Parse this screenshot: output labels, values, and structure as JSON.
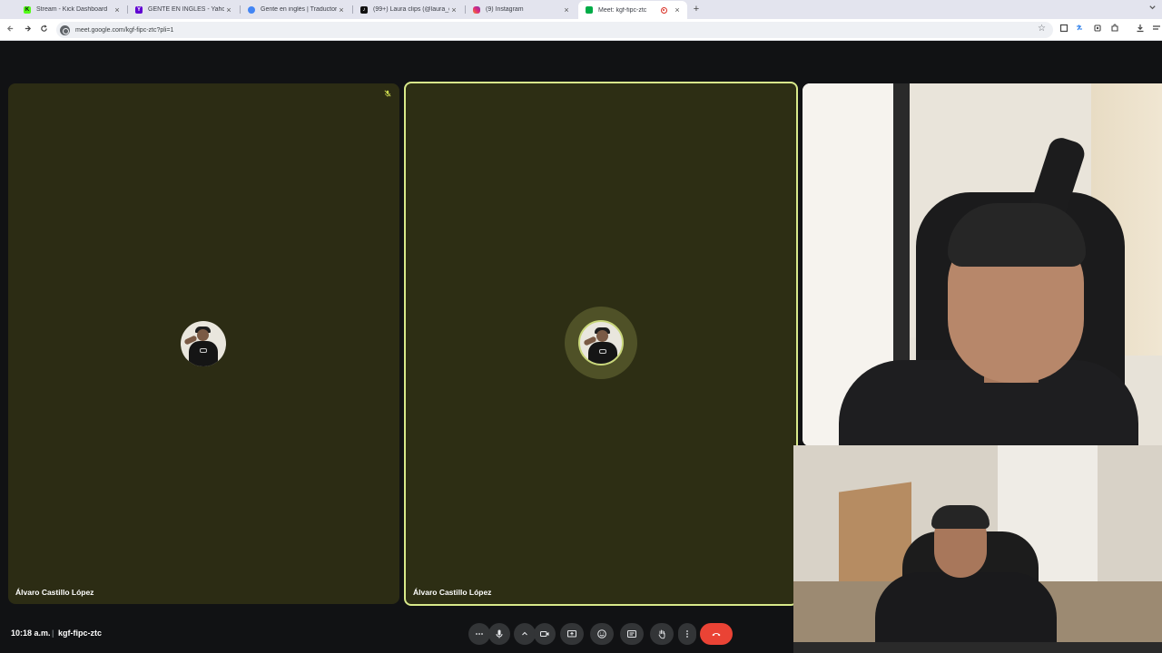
{
  "browser": {
    "tabs": [
      {
        "title": "Stream - Kick Dashboard",
        "favicon_color": "#53fc18",
        "favicon_letter": "K"
      },
      {
        "title": "GENTE EN INGLÉS - Yahoo Sea",
        "favicon_color": "#6001d2",
        "favicon_letter": "Y"
      },
      {
        "title": "Gente en inglés | Traductor de",
        "favicon_color": "#4285f4",
        "favicon_letter": ""
      },
      {
        "title": "(99+) Laura clips (@laura_clips_",
        "favicon_color": "#111111",
        "favicon_letter": "♪"
      },
      {
        "title": "(9) Instagram",
        "favicon_color": "#e1306c",
        "favicon_letter": ""
      },
      {
        "title": "Meet: kgf-fipc-ztc",
        "favicon_color": "#00ac47",
        "favicon_letter": "",
        "active": true
      }
    ],
    "close_glyph": "×",
    "new_tab_glyph": "+",
    "url": "meet.google.com/kgf-fipc-ztc?pli=1"
  },
  "meet": {
    "participants": [
      {
        "name": "Álvaro Castillo López",
        "muted": true,
        "speaking": false
      },
      {
        "name": "Álvaro Castillo López",
        "muted": false,
        "speaking": true
      }
    ],
    "time": "10:18 a.m.",
    "separator": "|",
    "meeting_code": "kgf-fipc-ztc",
    "colors": {
      "tile_bg": "#2c2c14",
      "speaking_border": "#d8e98a",
      "leave_button": "#ea4335",
      "control_bg": "#333537"
    }
  }
}
